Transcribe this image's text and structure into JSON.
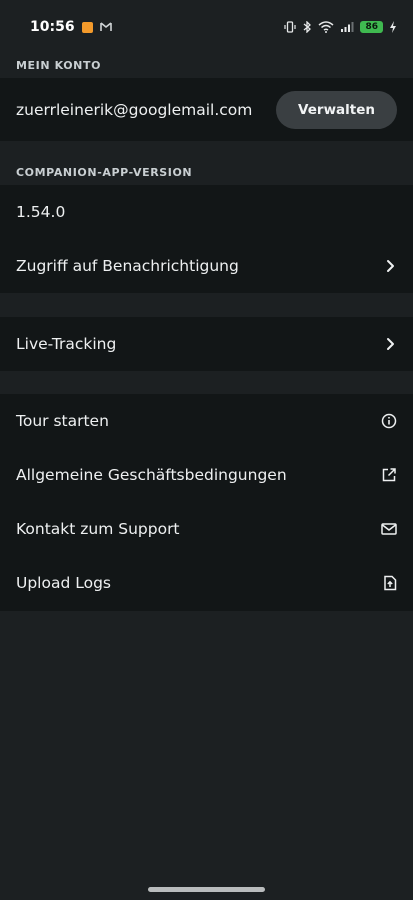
{
  "status_bar": {
    "time": "10:56",
    "battery": "86"
  },
  "account": {
    "section_title": "MEIN KONTO",
    "email": "zuerrleinerik@googlemail.com",
    "manage_label": "Verwalten"
  },
  "app_version": {
    "section_title": "COMPANION-APP-VERSION",
    "version": "1.54.0",
    "notification_access_label": "Zugriff auf Benachrichtigung"
  },
  "live_tracking": {
    "label": "Live-Tracking"
  },
  "links": {
    "tour_label": "Tour starten",
    "terms_label": "Allgemeine Geschäftsbedingungen",
    "support_label": "Kontakt zum Support",
    "upload_label": "Upload Logs"
  },
  "colors": {
    "background": "#1c2022",
    "card": "#121617",
    "battery": "#3fb950"
  }
}
